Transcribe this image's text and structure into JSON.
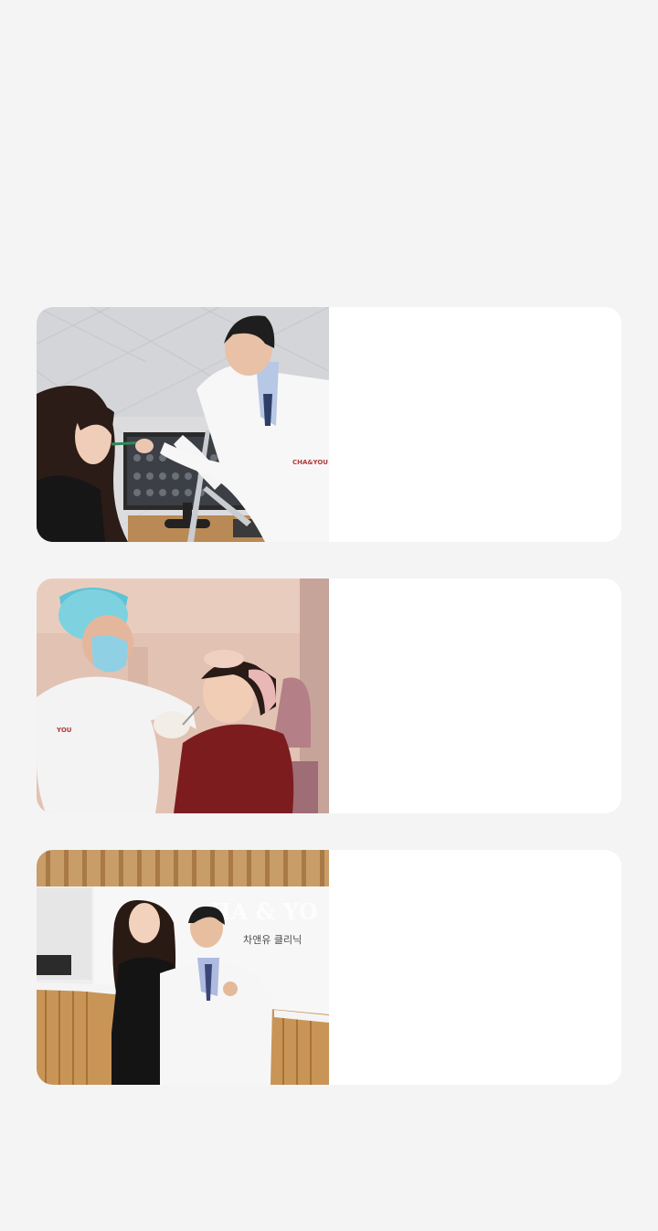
{
  "cards": [
    {
      "name": "consultation-card",
      "photo_icon": "doctor-consultation-photo",
      "coat_logo": "CHA&YOU"
    },
    {
      "name": "treatment-card",
      "photo_icon": "injection-treatment-photo",
      "coat_logo": "YOU"
    },
    {
      "name": "clinic-card",
      "photo_icon": "clinic-reception-photo",
      "sign_brand": "HA & YO",
      "sign_korean": "차앤유 클리닉"
    }
  ]
}
